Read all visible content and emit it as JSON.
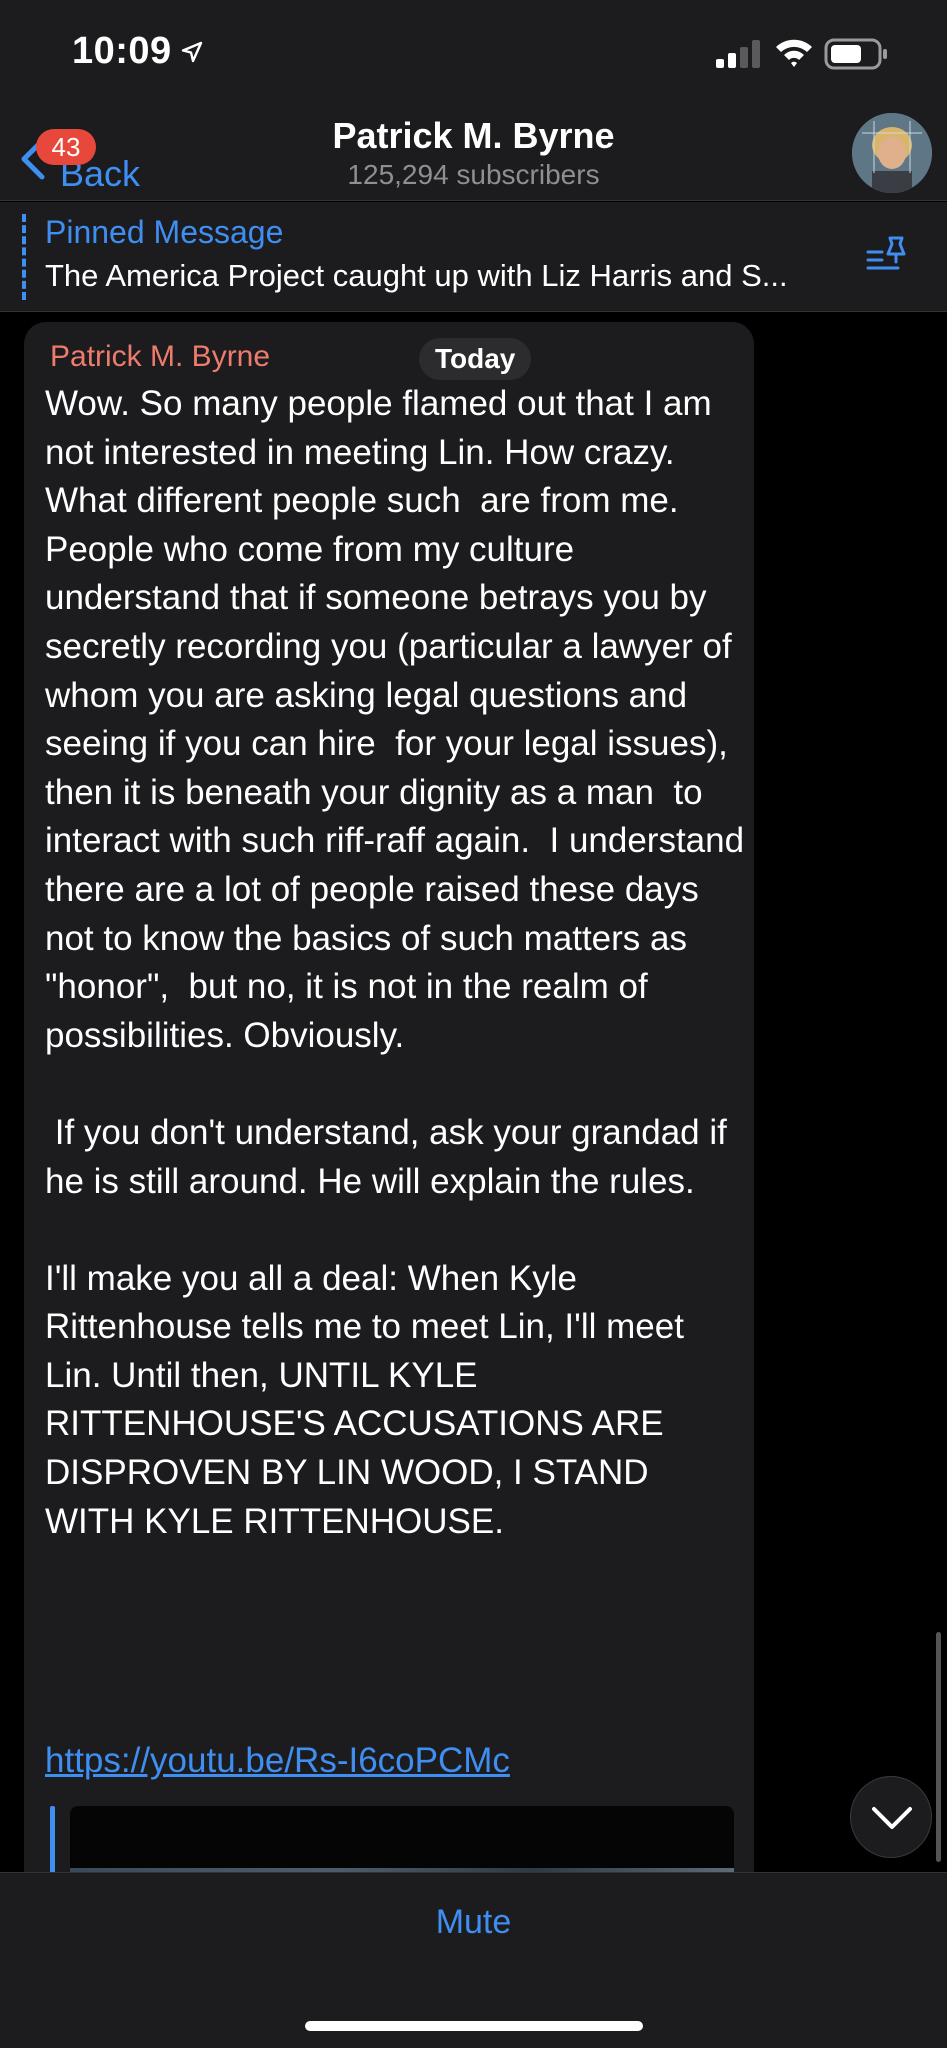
{
  "status_bar": {
    "time": "10:09"
  },
  "header": {
    "back_label": "Back",
    "unread_count": "43",
    "title": "Patrick M. Byrne",
    "subtitle": "125,294 subscribers"
  },
  "pinned": {
    "title": "Pinned Message",
    "text": "The America Project caught up with Liz Harris and S..."
  },
  "message": {
    "author": "Patrick M. Byrne",
    "date_label": "Today",
    "text": "Wow. So many people flamed out that I am not interested in meeting Lin. How crazy. What different people such  are from me.  People who come from my culture  understand that if someone betrays you by secretly recording you (particular a lawyer of whom you are asking legal questions and seeing if you can hire  for your legal issues), then it is beneath your dignity as a man  to interact with such riff-raff again.  I understand there are a lot of people raised these days not to know the basics of such matters as \"honor\",  but no, it is not in the realm of possibilities. Obviously.\n\n If you don't understand, ask your grandad if he is still around. He will explain the rules.\n\nI'll make you all a deal: When Kyle Rittenhouse tells me to meet Lin, I'll meet Lin. Until then, UNTIL KYLE RITTENHOUSE'S ACCUSATIONS ARE DISPROVEN BY LIN WOOD, I STAND WITH KYLE RITTENHOUSE.",
    "link": "https://youtu.be/Rs-I6coPCMc"
  },
  "bottom": {
    "mute_label": "Mute"
  },
  "colors": {
    "accent": "#3f8ef2",
    "author": "#ee7b6e",
    "badge": "#e8483b",
    "bubble": "#1c1c1e"
  },
  "icons": [
    "location-arrow-icon",
    "signal-icon",
    "wifi-icon",
    "battery-icon",
    "chevron-left-icon",
    "pin-list-icon",
    "chevron-down-icon"
  ]
}
